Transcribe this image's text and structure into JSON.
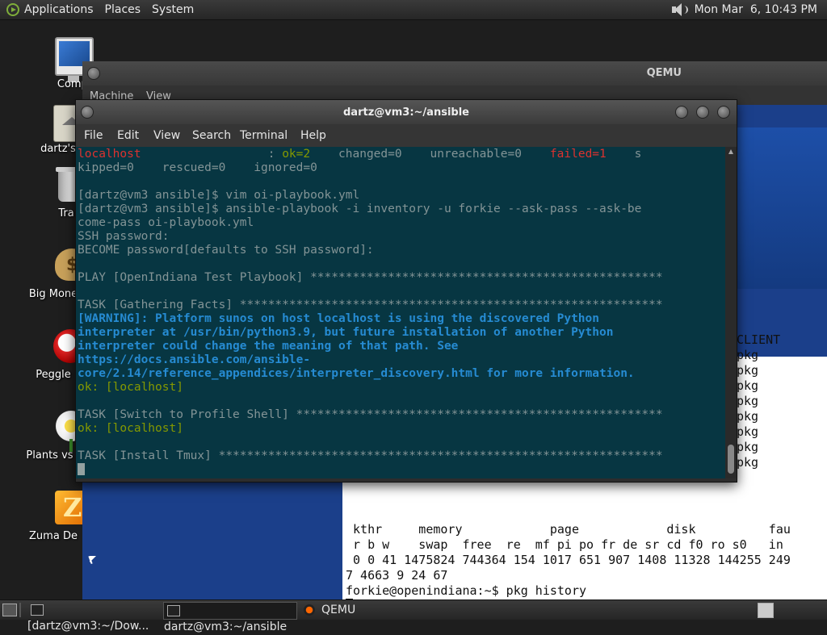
{
  "top_panel": {
    "menus": [
      "Applications",
      "Places",
      "System"
    ],
    "clock": "Mon Mar  6, 10:43 PM"
  },
  "desktop_icons": [
    {
      "label": "Compu",
      "icon": "computer-icon"
    },
    {
      "label": "dartz's",
      "icon": "home-folder-icon"
    },
    {
      "label": "Tra",
      "icon": "trash-icon"
    },
    {
      "label": "Big Mone",
      "icon": "money-bag-icon"
    },
    {
      "label": "Peggle",
      "icon": "peggle-icon"
    },
    {
      "label": "Plants vs Z",
      "icon": "flower-icon"
    },
    {
      "label": "Zuma De",
      "icon": "zuma-icon"
    }
  ],
  "qemu_window": {
    "title": "QEMU",
    "menus": [
      "Machine",
      "View"
    ]
  },
  "guest_terminal": {
    "lines": [
      {
        "text": "CLIENT"
      },
      {
        "text": "pkg"
      },
      {
        "text": "pkg"
      },
      {
        "text": "pkg"
      },
      {
        "text": "pkg"
      },
      {
        "text": "pkg"
      },
      {
        "text": "pkg"
      },
      {
        "text": "pkg"
      },
      {
        "text": "pkg"
      },
      {
        "text": " kthr     memory            page            disk          fau"
      },
      {
        "text": " r b w    swap  free  re  mf pi po fr de sr cd f0 ro s0   in"
      },
      {
        "text": " 0 0 41 1475824 744364 154 1017 651 907 1408 11328 144255 249"
      },
      {
        "text": "7 4663 9 24 67"
      },
      {
        "text": "forkie@openindiana:~$ pkg history"
      }
    ]
  },
  "terminal_window": {
    "title": "dartz@vm3:~/ansible",
    "menus": [
      "File",
      "Edit",
      "View",
      "Search",
      "Terminal",
      "Help"
    ],
    "lines": [
      {
        "segs": [
          {
            "t": "localhost",
            "c": "c-red"
          },
          {
            "t": "                  : ",
            "c": "c-gray"
          },
          {
            "t": "ok=2",
            "c": "c-green"
          },
          {
            "t": "    changed=0    unreachable=0    ",
            "c": "c-gray"
          },
          {
            "t": "failed=1",
            "c": "c-red"
          },
          {
            "t": "    s",
            "c": "c-gray"
          }
        ]
      },
      {
        "segs": [
          {
            "t": "kipped=0    rescued=0    ignored=0",
            "c": "c-gray"
          }
        ]
      },
      {
        "segs": [
          {
            "t": "",
            "c": "c-gray"
          }
        ]
      },
      {
        "segs": [
          {
            "t": "[dartz@vm3 ansible]$ vim oi-playbook.yml",
            "c": "c-gray"
          }
        ]
      },
      {
        "segs": [
          {
            "t": "[dartz@vm3 ansible]$ ansible-playbook -i inventory -u forkie --ask-pass --ask-be",
            "c": "c-gray"
          }
        ]
      },
      {
        "segs": [
          {
            "t": "come-pass oi-playbook.yml",
            "c": "c-gray"
          }
        ]
      },
      {
        "segs": [
          {
            "t": "SSH password:",
            "c": "c-gray"
          }
        ]
      },
      {
        "segs": [
          {
            "t": "BECOME password[defaults to SSH password]:",
            "c": "c-gray"
          }
        ]
      },
      {
        "segs": [
          {
            "t": "",
            "c": "c-gray"
          }
        ]
      },
      {
        "segs": [
          {
            "t": "PLAY [OpenIndiana Test Playbook] **************************************************",
            "c": "c-gray"
          }
        ]
      },
      {
        "segs": [
          {
            "t": "",
            "c": "c-gray"
          }
        ]
      },
      {
        "segs": [
          {
            "t": "TASK [Gathering Facts] ************************************************************",
            "c": "c-gray"
          }
        ]
      },
      {
        "segs": [
          {
            "t": "[WARNING]: Platform sunos on host localhost is using the discovered Python",
            "c": "c-blue"
          }
        ]
      },
      {
        "segs": [
          {
            "t": "interpreter at /usr/bin/python3.9, but future installation of another Python",
            "c": "c-blue"
          }
        ]
      },
      {
        "segs": [
          {
            "t": "interpreter could change the meaning of that path. See",
            "c": "c-blue"
          }
        ]
      },
      {
        "segs": [
          {
            "t": "https://docs.ansible.com/ansible-",
            "c": "c-blue"
          }
        ]
      },
      {
        "segs": [
          {
            "t": "core/2.14/reference_appendices/interpreter_discovery.html for more information.",
            "c": "c-blue"
          }
        ]
      },
      {
        "segs": [
          {
            "t": "ok: [localhost]",
            "c": "c-green"
          }
        ]
      },
      {
        "segs": [
          {
            "t": "",
            "c": "c-gray"
          }
        ]
      },
      {
        "segs": [
          {
            "t": "TASK [Switch to Profile Shell] ****************************************************",
            "c": "c-gray"
          }
        ]
      },
      {
        "segs": [
          {
            "t": "ok: [localhost]",
            "c": "c-green"
          }
        ]
      },
      {
        "segs": [
          {
            "t": "",
            "c": "c-gray"
          }
        ]
      },
      {
        "segs": [
          {
            "t": "TASK [Install Tmux] ***************************************************************",
            "c": "c-gray"
          }
        ]
      }
    ]
  },
  "taskbar": {
    "items": [
      {
        "label": "[dartz@vm3:~/Dow...",
        "icon": "terminal-icon",
        "active": false
      },
      {
        "label": "dartz@vm3:~/ansible",
        "icon": "terminal-icon",
        "active": true
      },
      {
        "label": "QEMU",
        "icon": "qemu-icon",
        "active": false
      }
    ]
  },
  "colors": {
    "terminal_bg": "#073642",
    "terminal_text": "#839496",
    "ok_green": "#859900",
    "failed_red": "#dc322f",
    "warning_blue": "#268bd2",
    "guest_desktop_blue": "#1b3f8a"
  }
}
